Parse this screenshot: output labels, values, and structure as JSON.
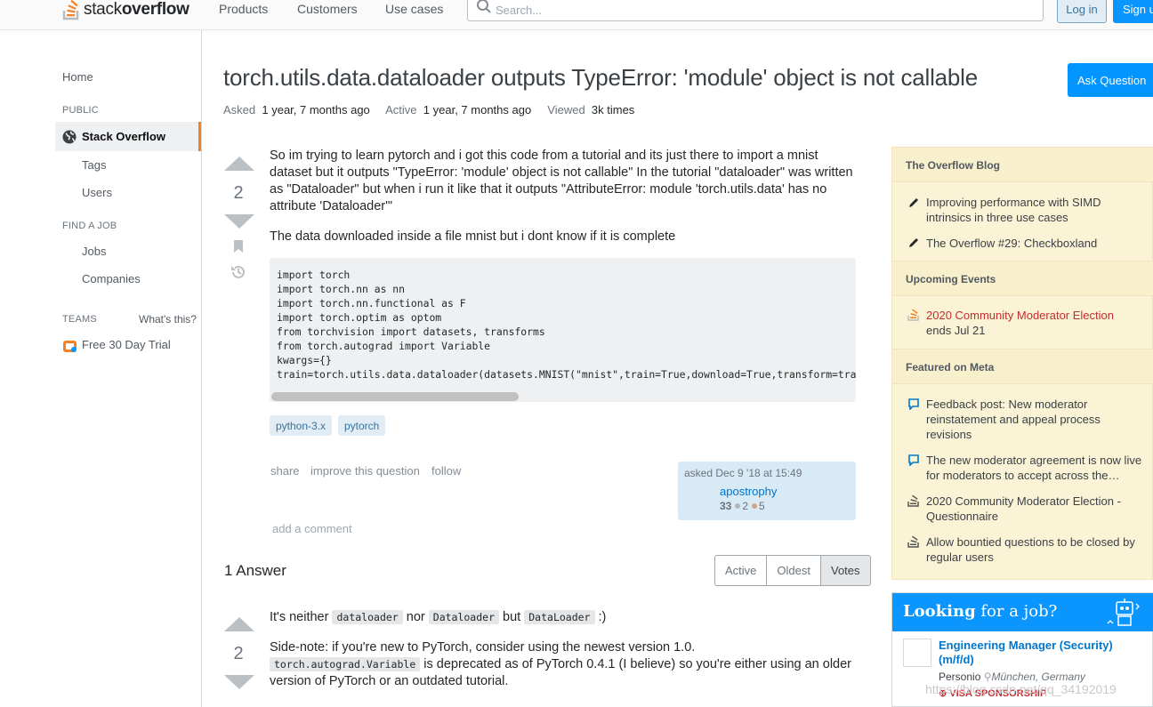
{
  "header": {
    "brand_light": "stack",
    "brand_bold": "overflow",
    "nav": [
      "Products",
      "Customers",
      "Use cases"
    ],
    "search_placeholder": "Search...",
    "login": "Log in",
    "signup": "Sign up"
  },
  "leftnav": {
    "home": "Home",
    "public": "PUBLIC",
    "stackoverflow": "Stack Overflow",
    "tags": "Tags",
    "users": "Users",
    "findjob": "FIND A JOB",
    "jobs": "Jobs",
    "companies": "Companies",
    "teams": "TEAMS",
    "whats_this": "What's this?",
    "trial": "Free 30 Day Trial"
  },
  "question": {
    "title": "torch.utils.data.dataloader outputs TypeError: 'module' object is not callable",
    "ask_button": "Ask Question",
    "asked_label": "Asked",
    "asked_value": "1 year, 7 months ago",
    "active_label": "Active",
    "active_value": "1 year, 7 months ago",
    "viewed_label": "Viewed",
    "viewed_value": "3k times",
    "votes": "2",
    "body1": "So im trying to learn pytorch and i got this code from a tutorial and its just there to import a mnist dataset but it outputs \"TypeError: 'module' object is not callable\" In the tutorial \"dataloader\" was written as \"Dataloader\" but when i run it like that it outputs \"AttributeError: module 'torch.utils.data' has no attribute 'Dataloader'\"",
    "body2": "The data downloaded inside a file mnist but i dont know if it is complete",
    "code": "import torch\nimport torch.nn as nn\nimport torch.nn.functional as F\nimport torch.optim as optom\nfrom torchvision import datasets, transforms\nfrom torch.autograd import Variable\nkwargs={}\ntrain=torch.utils.data.dataloader(datasets.MNIST(\"mnist\",train=True,download=True,transform=transforms.Compose",
    "tags": [
      "python-3.x",
      "pytorch"
    ],
    "menu": [
      "share",
      "improve this question",
      "follow"
    ],
    "owner_asked": "asked Dec 9 '18 at 15:49",
    "owner_name": "apostrophy",
    "owner_rep": "33",
    "owner_silver": "2",
    "owner_bronze": "5",
    "add_comment": "add a comment"
  },
  "answers": {
    "heading": "1 Answer",
    "sort": [
      "Active",
      "Oldest",
      "Votes"
    ],
    "votes": "2",
    "p1_a": "It's neither",
    "p1_code1": "dataloader",
    "p1_b": "nor",
    "p1_code2": "Dataloader",
    "p1_c": "but",
    "p1_code3": "DataLoader",
    "p1_d": ":)",
    "p2_a": "Side-note: if you're new to PyTorch, consider using the newest version 1.0.",
    "p2_code": "torch.autograd.Variable",
    "p2_b": "is deprecated as of PyTorch 0.4.1 (I believe) so you're either using an older version of PyTorch or an outdated tutorial."
  },
  "sidebar": {
    "blog_h": "The Overflow Blog",
    "blog": [
      "Improving performance with SIMD intrinsics in three use cases",
      "The Overflow #29: Checkboxland"
    ],
    "events_h": "Upcoming Events",
    "event_title": "2020 Community Moderator Election",
    "event_sub": "ends Jul 21",
    "meta_h": "Featured on Meta",
    "meta": [
      "Feedback post: New moderator reinstatement and appeal process revisions",
      "The new moderator agreement is now live for moderators to accept across the…",
      "2020 Community Moderator Election - Questionnaire",
      "Allow bountied questions to be closed by regular users"
    ]
  },
  "job": {
    "heading_bold": "Looking",
    "heading_rest": "for a job?",
    "title": "Engineering Manager (Security) (m/f/d)",
    "company": "Personio",
    "location": "München, Germany",
    "badge": "VISA SPONSORSHIP"
  },
  "watermark": "https://blog.csdn.net/qq_34192019",
  "colors": {
    "accent": "#f48024",
    "link": "#0074cc",
    "primary": "#0095ff"
  }
}
